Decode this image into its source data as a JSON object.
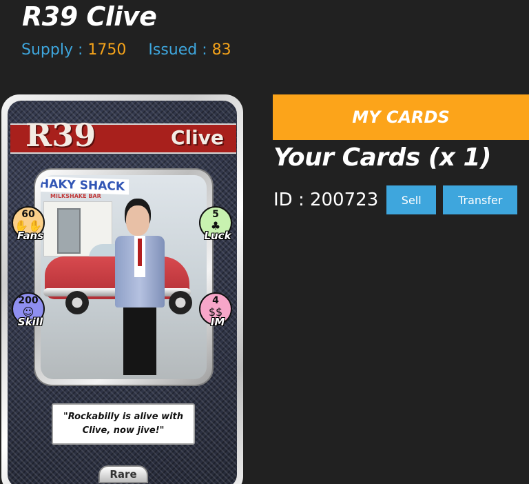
{
  "header": {
    "title": "R39 Clive",
    "supply_label": "Supply :",
    "supply_value": "1750",
    "issued_label": "Issued :",
    "issued_value": "83"
  },
  "card": {
    "code": "R39",
    "name": "Clive",
    "shop_sign": "HAKY SHACK",
    "shop_sub": "MILKSHAKE BAR",
    "stats": {
      "fans": {
        "value": "60",
        "label": "Fans",
        "color": "#fbd08a",
        "icon": "crowd-icon"
      },
      "luck": {
        "value": "5",
        "label": "Luck",
        "color": "#c8f2b0",
        "icon": "clover-icon"
      },
      "skill": {
        "value": "200",
        "label": "Skill",
        "color": "#8f8ff0",
        "icon": "juggler-icon"
      },
      "im": {
        "value": "4",
        "label": "IM",
        "color": "#f7a6c9",
        "icon": "money-icon"
      }
    },
    "quote": "\"Rockabilly is alive with Clive, now jive!\"",
    "rarity": "Rare"
  },
  "panel": {
    "my_cards_label": "MY CARDS",
    "your_cards_text": "Your Cards (x 1)",
    "id_text": "ID : 200723",
    "sell_label": "Sell",
    "transfer_label": "Transfer"
  },
  "colors": {
    "background": "#212121",
    "accent_orange": "#fca41a",
    "accent_blue": "#3ea6dd",
    "value_orange": "#f5a31a"
  }
}
